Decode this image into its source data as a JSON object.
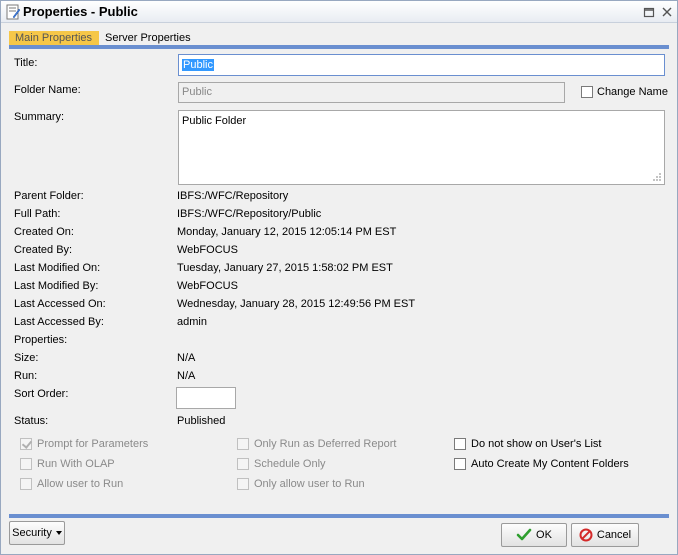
{
  "window": {
    "title": "Properties - Public"
  },
  "tabs": [
    {
      "label": "Main Properties"
    },
    {
      "label": "Server Properties"
    }
  ],
  "form": {
    "title_label": "Title:",
    "title_value": "Public",
    "folder_name_label": "Folder Name:",
    "folder_name_value": "Public",
    "change_name_label": "Change Name",
    "summary_label": "Summary:",
    "summary_value": "Public Folder"
  },
  "info": [
    {
      "label": "Parent Folder:",
      "value": "IBFS:/WFC/Repository"
    },
    {
      "label": "Full Path:",
      "value": "IBFS:/WFC/Repository/Public"
    },
    {
      "label": "Created On:",
      "value": "Monday, January 12, 2015 12:05:14 PM EST"
    },
    {
      "label": "Created By:",
      "value": "WebFOCUS"
    },
    {
      "label": "Last Modified On:",
      "value": "Tuesday, January 27, 2015 1:58:02 PM EST"
    },
    {
      "label": "Last Modified By:",
      "value": "WebFOCUS"
    },
    {
      "label": "Last Accessed On:",
      "value": "Wednesday, January 28, 2015 12:49:56 PM EST"
    },
    {
      "label": "Last Accessed By:",
      "value": "admin"
    },
    {
      "label": "Properties:",
      "value": ""
    },
    {
      "label": "Size:",
      "value": "N/A"
    },
    {
      "label": "Run:",
      "value": "N/A"
    }
  ],
  "sort_order": {
    "label": "Sort Order:",
    "value": ""
  },
  "status": {
    "label": "Status:",
    "value": "Published"
  },
  "options": {
    "prompt_params": {
      "label": "Prompt for Parameters",
      "checked": true,
      "disabled": true
    },
    "run_olap": {
      "label": "Run With OLAP",
      "checked": false,
      "disabled": true
    },
    "allow_user_run": {
      "label": "Allow user to Run",
      "checked": false,
      "disabled": true
    },
    "deferred_only": {
      "label": "Only Run as Deferred Report",
      "checked": false,
      "disabled": true
    },
    "schedule_only": {
      "label": "Schedule Only",
      "checked": false,
      "disabled": true
    },
    "only_allow_user_run": {
      "label": "Only allow user to Run",
      "checked": false,
      "disabled": true
    },
    "hide_on_list": {
      "label": "Do not show on User's List",
      "checked": false,
      "disabled": false
    },
    "auto_create": {
      "label": "Auto Create My Content Folders",
      "checked": false,
      "disabled": false
    }
  },
  "buttons": {
    "security": "Security",
    "ok": "OK",
    "cancel": "Cancel"
  },
  "colors": {
    "accent_blue": "#6a8fd0",
    "active_tab": "#f6c748",
    "ok_check": "#2e9e2e",
    "cancel_red": "#d42a2a"
  }
}
